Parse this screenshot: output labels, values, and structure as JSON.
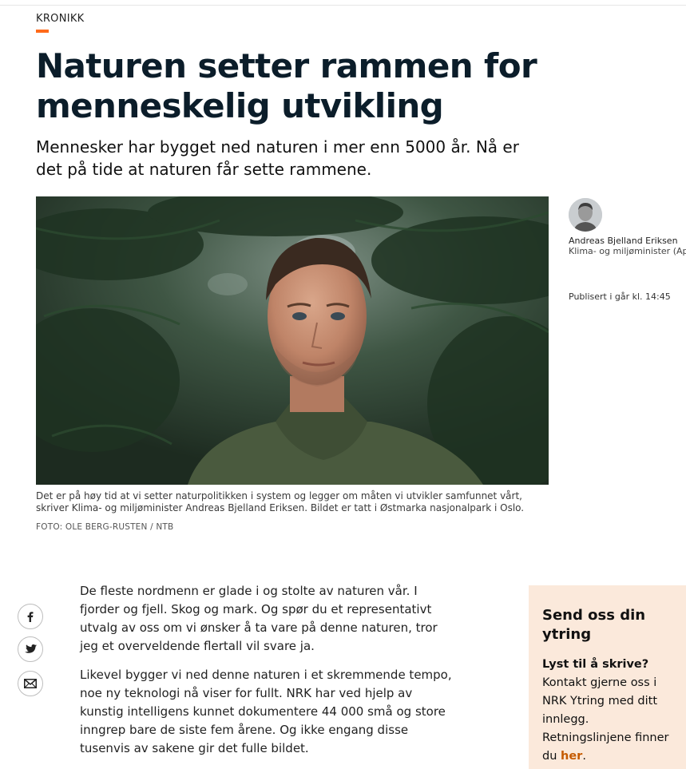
{
  "article": {
    "kicker": "KRONIKK",
    "headline": "Naturen setter rammen for menneskelig utvikling",
    "lead": "Mennesker har bygget ned naturen i mer enn 5000 år. Nå er det på tide at naturen får sette rammene.",
    "image_caption": "Det er på høy tid at vi setter naturpolitikken i system og legger om måten vi utvikler samfunnet vårt, skriver Klima- og miljøminister Andreas Bjelland Eriksen. Bildet er tatt i Østmarka nasjonalpark i Oslo.",
    "image_credit": "FOTO: OLE BERG-RUSTEN / NTB",
    "paragraphs": [
      "De fleste nordmenn er glade i og stolte av naturen vår. I fjorder og fjell. Skog og mark. Og spør du et representativt utvalg av oss om vi ønsker å ta vare på denne naturen, tror jeg et overveldende flertall vil svare ja.",
      "Likevel bygger vi ned denne naturen i et skremmende tempo, noe ny teknologi nå viser for fullt. NRK har ved hjelp av kunstig intelligens kunnet dokumentere 44 000 små og store inngrep bare de siste fem årene. Og ikke engang disse tusenvis av sakene gir det fulle bildet."
    ]
  },
  "author": {
    "name": "Andreas Bjelland Eriksen",
    "role": "Klima- og miljøminister (Ap)",
    "published": "Publisert i går kl. 14:45"
  },
  "share": [
    {
      "icon": "facebook-icon"
    },
    {
      "icon": "twitter-icon"
    },
    {
      "icon": "email-icon"
    }
  ],
  "send_box": {
    "title": "Send oss din ytring",
    "lead": "Lyst til å skrive?",
    "text": "Kontakt gjerne oss i NRK Ytring med ditt innlegg. Retningslinjene finner du",
    "link_label": "her",
    "link_suffix": "."
  },
  "colors": {
    "accent": "#ff6a1a",
    "headline": "#0b1d2a",
    "send_box_bg": "#fbe9db",
    "link": "#c55a00"
  }
}
